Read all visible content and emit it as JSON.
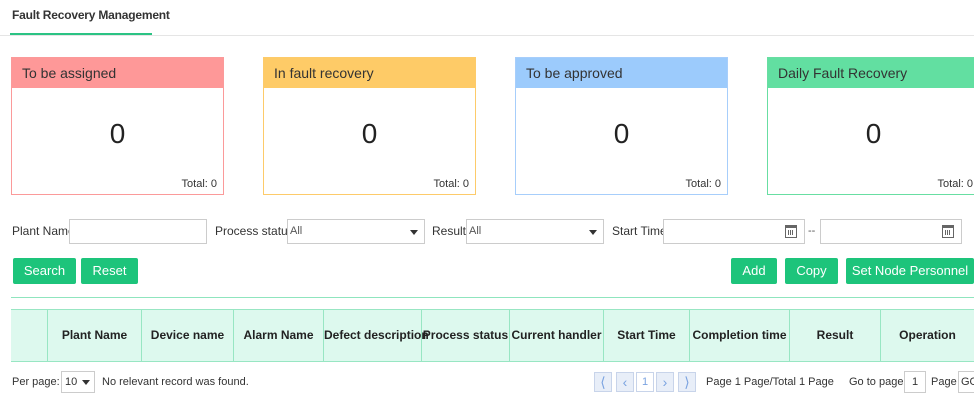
{
  "tab": {
    "label": "Fault Recovery Management"
  },
  "cards": [
    {
      "title": "To be assigned",
      "value": "0",
      "total": "Total: 0",
      "color": "#fe9898"
    },
    {
      "title": "In fault recovery",
      "value": "0",
      "total": "Total: 0",
      "color": "#fecb67"
    },
    {
      "title": "To be approved",
      "value": "0",
      "total": "Total: 0",
      "color": "#9ccbfc"
    },
    {
      "title": "Daily Fault Recovery",
      "value": "0",
      "total": "Total: 0",
      "color": "#62dfa1"
    }
  ],
  "filters": {
    "plant_name_label": "Plant Name",
    "plant_name_value": "",
    "process_status_label": "Process status",
    "process_status_value": "All",
    "result_label": "Result",
    "result_value": "All",
    "start_time_label": "Start Time",
    "start_time_from": "",
    "range_separator": "--",
    "start_time_to": ""
  },
  "buttons": {
    "search": "Search",
    "reset": "Reset",
    "add": "Add",
    "copy": "Copy",
    "set_node_personnel": "Set Node Personnel"
  },
  "table": {
    "columns": [
      "Plant Name",
      "Device name",
      "Alarm Name",
      "Defect description",
      "Process status",
      "Current handler",
      "Start Time",
      "Completion time",
      "Result",
      "Operation"
    ],
    "rows": []
  },
  "pager": {
    "per_page_label": "Per page:",
    "per_page_value": "10",
    "no_records": "No relevant record was found.",
    "first_icon": "first-page-icon",
    "prev_icon": "prev-page-icon",
    "current_page": "1",
    "next_icon": "next-page-icon",
    "last_icon": "last-page-icon",
    "page_info": "Page 1 Page/Total 1 Page",
    "goto_label": "Go to page",
    "goto_value": "1",
    "page_suffix": "Page",
    "go_label": "GO"
  },
  "colors": {
    "accent": "#1dc47b",
    "header_bg": "#ddf9ee"
  }
}
